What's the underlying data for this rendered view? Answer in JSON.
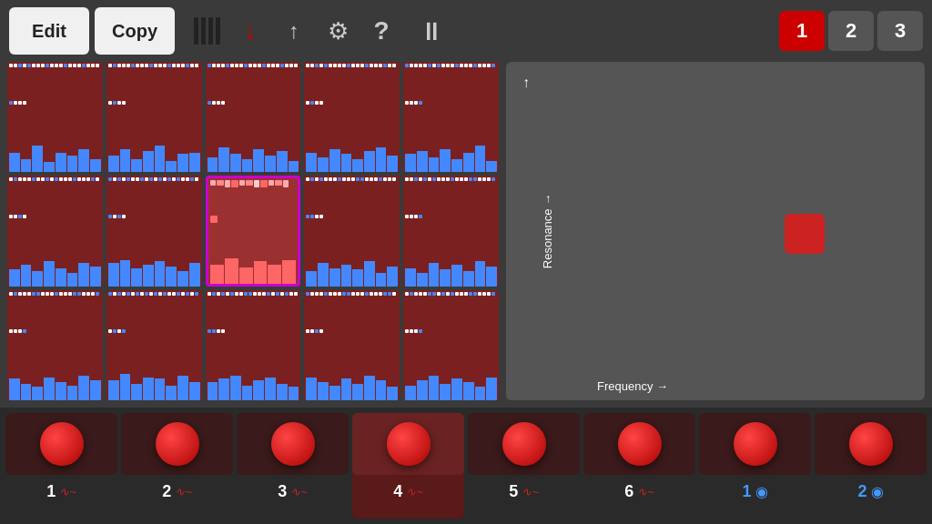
{
  "toolbar": {
    "edit_label": "Edit",
    "copy_label": "Copy",
    "pause_symbol": "⏸",
    "question_label": "?"
  },
  "tabs": [
    {
      "label": "1",
      "active": true
    },
    {
      "label": "2",
      "active": false
    },
    {
      "label": "3",
      "active": false
    }
  ],
  "grid": {
    "rows": 3,
    "cols": 5,
    "active_cell": {
      "row": 1,
      "col": 2
    }
  },
  "chart": {
    "resonance_label": "Resonance →",
    "frequency_label": "Frequency →"
  },
  "channels": [
    {
      "num": "1",
      "type": "wave",
      "highlighted": false,
      "blue": false
    },
    {
      "num": "2",
      "type": "wave",
      "highlighted": false,
      "blue": false
    },
    {
      "num": "3",
      "type": "wave",
      "highlighted": false,
      "blue": false
    },
    {
      "num": "4",
      "type": "wave",
      "highlighted": true,
      "blue": false
    },
    {
      "num": "5",
      "type": "wave",
      "highlighted": false,
      "blue": false
    },
    {
      "num": "6",
      "type": "wave",
      "highlighted": false,
      "blue": false
    },
    {
      "num": "1",
      "type": "eye",
      "highlighted": false,
      "blue": true
    },
    {
      "num": "2",
      "type": "eye",
      "highlighted": false,
      "blue": true
    }
  ]
}
